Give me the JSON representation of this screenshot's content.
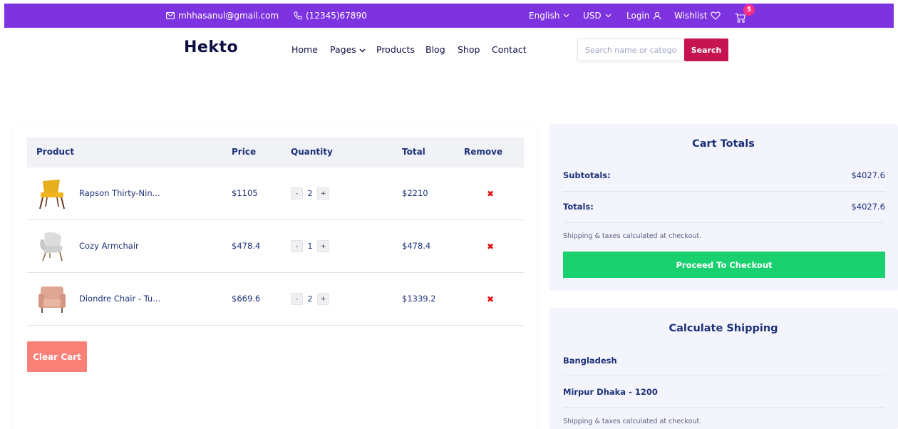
{
  "topbar": {
    "email": "mhhasanul@gmail.com",
    "phone": "(12345)67890",
    "language": "English",
    "currency": "USD",
    "login": "Login",
    "wishlist": "Wishlist",
    "cart_count": "5",
    "bg_color": "#7e33e0"
  },
  "header": {
    "logo": "Hekto",
    "nav": [
      "Home",
      "Pages",
      "Products",
      "Blog",
      "Shop",
      "Contact"
    ],
    "search_placeholder": "Search name or category",
    "search_button": "Search"
  },
  "cart": {
    "columns": [
      "Product",
      "Price",
      "Quantity",
      "Total",
      "Remove"
    ],
    "items": [
      {
        "name": "Rapson Thirty-Nin...",
        "price": "$1105",
        "qty": "2",
        "total": "$2210",
        "thumb_icon": "yellow-chair-icon"
      },
      {
        "name": "Cozy Armchair",
        "price": "$478.4",
        "qty": "1",
        "total": "$478.4",
        "thumb_icon": "grey-armchair-icon"
      },
      {
        "name": "Diondre Chair - Tu...",
        "price": "$669.6",
        "qty": "2",
        "total": "$1339.2",
        "thumb_icon": "pink-armchair-icon"
      }
    ],
    "minus": "-",
    "plus": "+",
    "remove_glyph": "✖",
    "clear_button": "Clear Cart"
  },
  "totals": {
    "title": "Cart Totals",
    "subtotal_label": "Subtotals:",
    "subtotal_value": "$4027.6",
    "total_label": "Totals:",
    "total_value": "$4027.6",
    "note": "Shipping & taxes calculated at checkout.",
    "checkout_button": "Proceed To Checkout"
  },
  "shipping": {
    "title": "Calculate Shipping",
    "country": "Bangladesh",
    "city": "Mirpur Dhaka - 1200",
    "note": "Shipping & taxes calculated at checkout."
  },
  "colors": {
    "accent": "#7e33e0",
    "pink": "#fb2e86",
    "search_button": "#c5144f",
    "checkout_green": "#19d16f",
    "clear_cart": "#fa8078",
    "navy_text": "#1d3178"
  }
}
